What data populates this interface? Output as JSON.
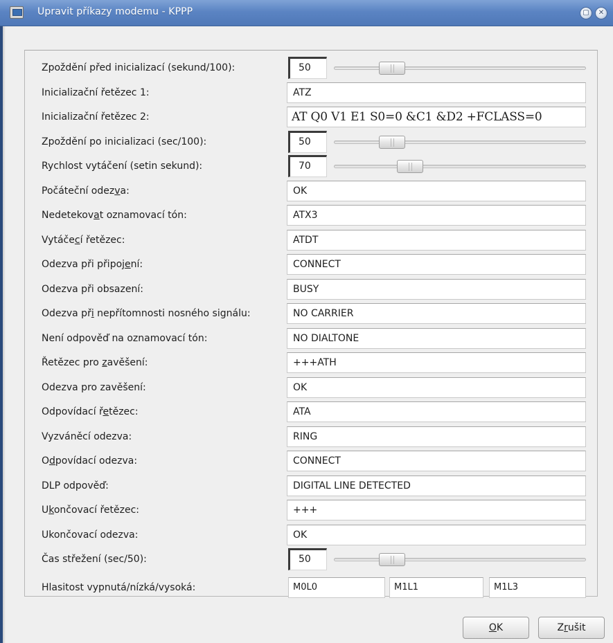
{
  "window": {
    "title": "Upravit příkazy modemu - KPPP"
  },
  "rows": [
    {
      "label": "Zpoždění před inicializací (sekund/100):",
      "value": "50",
      "slider": 0.2
    },
    {
      "label": "Inicializační řetězec 1:",
      "value": "ATZ"
    },
    {
      "label": "Inicializační řetězec 2:",
      "value": "AT Q0 V1 E1 S0=0 &C1 &D2 +FCLASS=0"
    },
    {
      "label": "Zpoždění po inicializaci (sec/100):",
      "value": "50",
      "slider": 0.2
    },
    {
      "label": "Rychlost vytáčení (setin sekund):",
      "value": "70",
      "slider": 0.28
    },
    {
      "label_pre": "Počáteční odez",
      "label_mn": "v",
      "label_post": "a:",
      "value": "OK"
    },
    {
      "label_pre": "Nedetekov",
      "label_mn": "a",
      "label_post": "t oznamovací tón:",
      "value": "ATX3"
    },
    {
      "label_pre": "Vytáče",
      "label_mn": "c",
      "label_post": "í řetězec:",
      "value": "ATDT"
    },
    {
      "label_pre": "Odezva při připoj",
      "label_mn": "e",
      "label_post": "ní:",
      "value": "CONNECT"
    },
    {
      "label": "Odezva při obsazení:",
      "value": "BUSY"
    },
    {
      "label_pre": "Odezva př",
      "label_mn": "i",
      "label_post": " nepřítomnosti nosného signálu:",
      "value": "NO CARRIER"
    },
    {
      "label": "Není odpověď na oznamovací tón:",
      "value": "NO DIALTONE"
    },
    {
      "label_pre": "Řetězec pro ",
      "label_mn": "z",
      "label_post": "avěšení:",
      "value": "+++ATH"
    },
    {
      "label": "Odezva pro zavěšení:",
      "value": "OK"
    },
    {
      "label_pre": "Odpovídací ř",
      "label_mn": "e",
      "label_post": "tězec:",
      "value": "ATA"
    },
    {
      "label": "Vyzváněcí odezva:",
      "value": "RING"
    },
    {
      "label_pre": "O",
      "label_mn": "d",
      "label_post": "povídací odezva:",
      "value": "CONNECT"
    },
    {
      "label": "DLP odpověď:",
      "value": "DIGITAL LINE DETECTED"
    },
    {
      "label_pre": "U",
      "label_mn": "k",
      "label_post": "ončovací řetězec:",
      "value": "+++"
    },
    {
      "label": "Ukončovací odezva:",
      "value": "OK"
    },
    {
      "label": "Čas střežení (sec/50):",
      "value": "50",
      "slider": 0.2
    }
  ],
  "volume": {
    "label": "Hlasitost vypnutá/nízká/vysoká:",
    "off": "M0L0",
    "low": "M1L1",
    "high": "M1L3"
  },
  "buttons": {
    "ok_mn": "O",
    "ok_rest": "K",
    "cancel_pre": "Z",
    "cancel_mn": "r",
    "cancel_post": "ušit"
  }
}
